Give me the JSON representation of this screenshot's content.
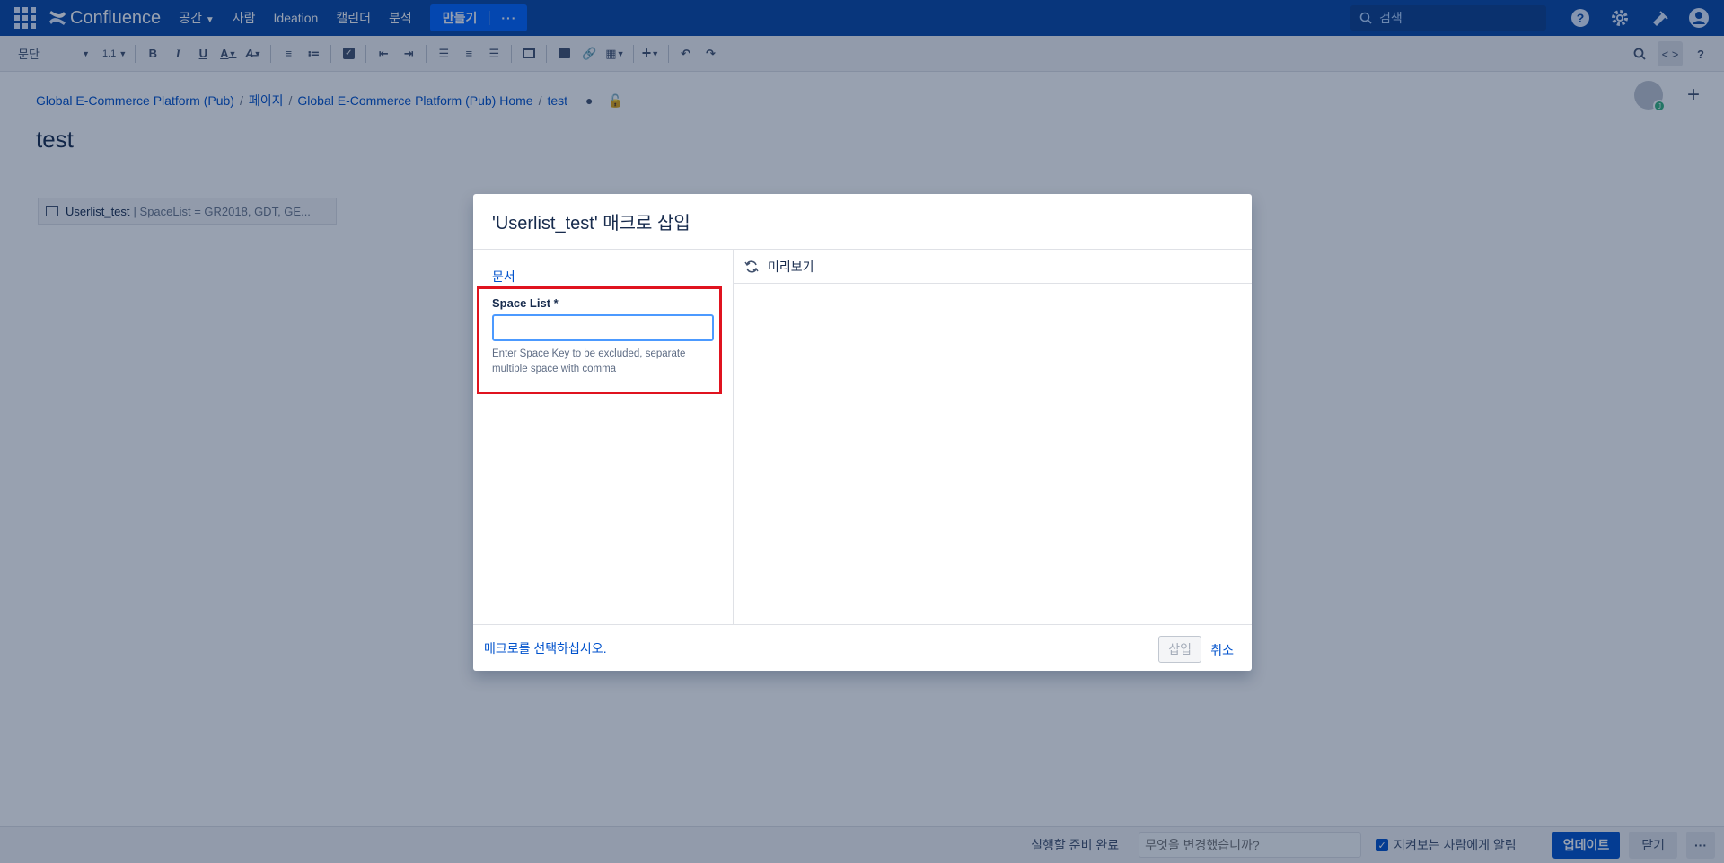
{
  "topnav": {
    "brand": "Confluence",
    "links": [
      "공간",
      "사람",
      "Ideation",
      "캘린더",
      "분석"
    ],
    "create_label": "만들기",
    "more_label": "···",
    "search_placeholder": "검색",
    "bg_color": "#0747a6"
  },
  "toolbar": {
    "paragraph_label": "문단",
    "line_height_label": "1.1"
  },
  "breadcrumb": {
    "items": [
      "Global E-Commerce Platform (Pub)",
      "페이지",
      "Global E-Commerce Platform (Pub) Home",
      "test"
    ]
  },
  "page": {
    "title": "test",
    "macro_placeholder": {
      "name": "Userlist_test",
      "params": "| SpaceList = GR2018, GDT, GE..."
    }
  },
  "dialog": {
    "title": "'Userlist_test' 매크로 삽입",
    "doc_link": "문서",
    "field_label": "Space List *",
    "field_value": "",
    "field_help": "Enter Space Key to be excluded, separate multiple space with comma",
    "preview_label": "미리보기",
    "footer_link": "매크로를 선택하십시오.",
    "insert_label": "삽입",
    "cancel_label": "취소",
    "highlight_color": "#e0131f"
  },
  "bottombar": {
    "status": "실행할 준비 완료",
    "comment_placeholder": "무엇을 변경했습니까?",
    "watch_label": "지켜보는 사람에게 알림",
    "watch_checked": true,
    "update_label": "업데이트",
    "close_label": "닫기",
    "more_label": "···"
  },
  "icons": [
    "app-switcher-icon",
    "search-icon",
    "help-icon",
    "settings-icon",
    "notification-icon",
    "user-avatar-icon",
    "refresh-icon"
  ]
}
